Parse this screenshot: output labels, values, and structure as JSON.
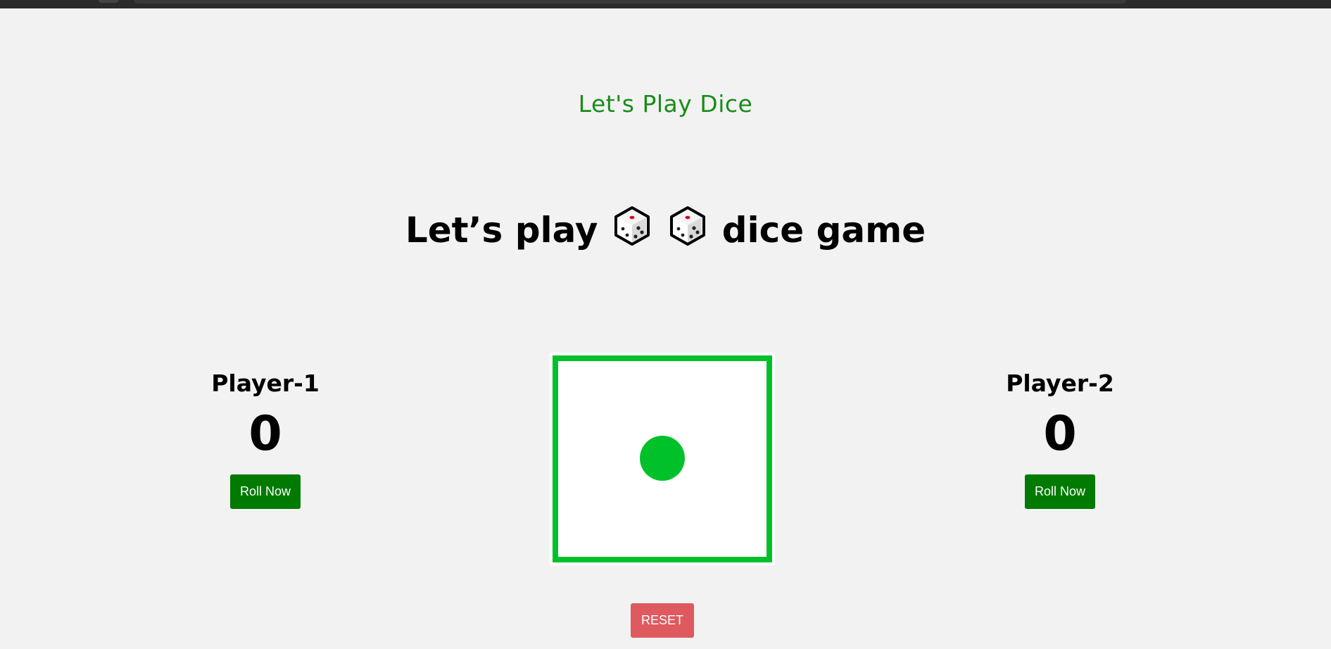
{
  "subtitle": "Let's Play Dice",
  "headline": {
    "before": "Let’s play",
    "after": "dice game",
    "icons": [
      "die-emoji-icon",
      "die-emoji-icon"
    ]
  },
  "players": [
    {
      "name": "Player-1",
      "score": "0",
      "button_label": "Roll Now"
    },
    {
      "name": "Player-2",
      "score": "0",
      "button_label": "Roll Now"
    }
  ],
  "dice": {
    "face_value": 1,
    "color": "#00c12a"
  },
  "reset_label": "RESET",
  "colors": {
    "subtitle": "#198c19",
    "roll_button": "#007a00",
    "reset_button": "#de5a5f",
    "background": "#f2f2f2"
  }
}
